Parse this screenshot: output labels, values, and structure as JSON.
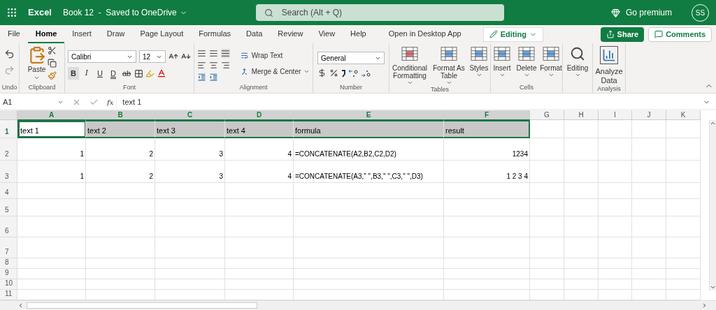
{
  "top_bar": {
    "app_name": "Excel",
    "document_title": "Book 12  -  Saved to OneDrive",
    "search_placeholder": "Search (Alt + Q)",
    "premium_label": "Go premium",
    "avatar_initials": "SS"
  },
  "menu_tabs": [
    {
      "label": "File",
      "selected": false
    },
    {
      "label": "Home",
      "selected": true
    },
    {
      "label": "Insert",
      "selected": false
    },
    {
      "label": "Draw",
      "selected": false
    },
    {
      "label": "Page Layout",
      "selected": false
    },
    {
      "label": "Formulas",
      "selected": false
    },
    {
      "label": "Data",
      "selected": false
    },
    {
      "label": "Review",
      "selected": false
    },
    {
      "label": "View",
      "selected": false
    },
    {
      "label": "Help",
      "selected": false
    },
    {
      "label": "Open in Desktop App",
      "selected": false
    }
  ],
  "mode_button": "Editing",
  "share_button": "Share",
  "comments_button": "Comments",
  "ribbon": {
    "groups": [
      "Undo",
      "Clipboard",
      "Font",
      "Alignment",
      "Number",
      "Tables",
      "Cells",
      "Analysis"
    ],
    "paste_label": "Paste",
    "font_name": "Calibri",
    "font_size": "12",
    "format_buttons": [
      {
        "label": "B",
        "kind": "bold",
        "selected": true
      },
      {
        "label": "I",
        "kind": "italic",
        "selected": false
      },
      {
        "label": "U",
        "kind": "underline",
        "selected": false
      },
      {
        "label": "D",
        "kind": "double",
        "selected": false
      },
      {
        "label": "ab",
        "kind": "strike",
        "selected": false
      }
    ],
    "wrap_text": "Wrap Text",
    "merge_center": "Merge & Center",
    "number_format": "General",
    "tables_buttons": [
      "Conditional Formatting",
      "Format As Table",
      "Styles"
    ],
    "cells_buttons": [
      "Insert",
      "Delete",
      "Format"
    ],
    "editing_button": "Editing",
    "analyze_button": "Analyze Data"
  },
  "formula_bar": {
    "name_box": "A1",
    "fx": "fx",
    "formula": "text 1"
  },
  "sheet": {
    "columns": [
      {
        "label": "A",
        "selected": true
      },
      {
        "label": "B",
        "selected": true
      },
      {
        "label": "C",
        "selected": true
      },
      {
        "label": "D",
        "selected": true
      },
      {
        "label": "E",
        "selected": true
      },
      {
        "label": "F",
        "selected": true
      },
      {
        "label": "G",
        "selected": false
      },
      {
        "label": "H",
        "selected": false
      },
      {
        "label": "I",
        "selected": false
      },
      {
        "label": "J",
        "selected": false
      },
      {
        "label": "K",
        "selected": false
      }
    ],
    "rows": [
      {
        "number": "1",
        "cells": [
          {
            "text": "text 1",
            "kind": "header",
            "selected": true,
            "active": true
          },
          {
            "text": "text 2",
            "kind": "header",
            "selected": true,
            "active": false
          },
          {
            "text": "text 3",
            "kind": "header",
            "selected": true,
            "active": false
          },
          {
            "text": "text 4",
            "kind": "header",
            "selected": true,
            "active": false
          },
          {
            "text": "formula",
            "kind": "header",
            "selected": true,
            "active": false
          },
          {
            "text": "result",
            "kind": "header",
            "selected": true,
            "active": false
          }
        ]
      },
      {
        "number": "2",
        "cells": [
          {
            "text": "1",
            "kind": "number",
            "selected": false,
            "active": false
          },
          {
            "text": "2",
            "kind": "number",
            "selected": false,
            "active": false
          },
          {
            "text": "3",
            "kind": "number",
            "selected": false,
            "active": false
          },
          {
            "text": "4",
            "kind": "number",
            "selected": false,
            "active": false
          },
          {
            "text": "=CONCATENATE(A2,B2,C2,D2)",
            "kind": "text",
            "selected": false,
            "active": false
          },
          {
            "text": "1234",
            "kind": "number",
            "selected": false,
            "active": false
          }
        ]
      },
      {
        "number": "3",
        "cells": [
          {
            "text": "1",
            "kind": "number",
            "selected": false,
            "active": false
          },
          {
            "text": "2",
            "kind": "number",
            "selected": false,
            "active": false
          },
          {
            "text": "3",
            "kind": "number",
            "selected": false,
            "active": false
          },
          {
            "text": "4",
            "kind": "number",
            "selected": false,
            "active": false
          },
          {
            "text": "=CONCATENATE(A3,\" \",B3,\" \",C3,\" \",D3)",
            "kind": "text",
            "selected": false,
            "active": false
          },
          {
            "text": "1 2 3 4",
            "kind": "number",
            "selected": false,
            "active": false
          }
        ]
      },
      {
        "number": "4"
      },
      {
        "number": "5"
      },
      {
        "number": "6"
      },
      {
        "number": "7"
      },
      {
        "number": "8"
      },
      {
        "number": "9"
      },
      {
        "number": "10"
      },
      {
        "number": "11"
      }
    ]
  }
}
